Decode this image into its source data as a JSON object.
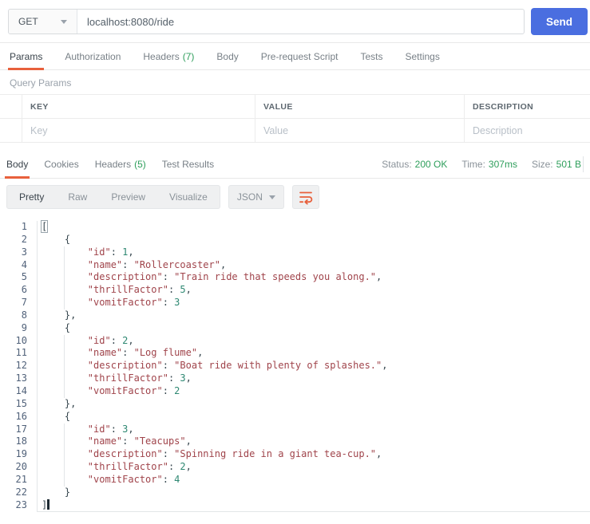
{
  "colors": {
    "accent_orange": "#E8603C",
    "green": "#2E9E5B",
    "send_blue": "#4A6EE0",
    "json_string": "#A0444B",
    "json_number": "#2E8872"
  },
  "request_bar": {
    "method": "GET",
    "url": "localhost:8080/ride",
    "send_label": "Send"
  },
  "request_tabs": [
    {
      "label": "Params",
      "active": true
    },
    {
      "label": "Authorization"
    },
    {
      "label": "Headers",
      "count": "(7)"
    },
    {
      "label": "Body"
    },
    {
      "label": "Pre-request Script"
    },
    {
      "label": "Tests"
    },
    {
      "label": "Settings"
    }
  ],
  "query_params": {
    "title": "Query Params",
    "columns": [
      "KEY",
      "VALUE",
      "DESCRIPTION"
    ],
    "placeholders": [
      "Key",
      "Value",
      "Description"
    ]
  },
  "response": {
    "tabs": [
      {
        "label": "Body",
        "active": true
      },
      {
        "label": "Cookies"
      },
      {
        "label": "Headers",
        "count": "(5)"
      },
      {
        "label": "Test Results"
      }
    ],
    "meta": [
      {
        "label": "Status:",
        "value": "200 OK"
      },
      {
        "label": "Time:",
        "value": "307ms"
      },
      {
        "label": "Size:",
        "value": "501 B"
      }
    ],
    "view_modes": [
      {
        "label": "Pretty",
        "active": true
      },
      {
        "label": "Raw"
      },
      {
        "label": "Preview"
      },
      {
        "label": "Visualize"
      }
    ],
    "format": "JSON"
  },
  "response_body": {
    "lines": [
      [
        [
          "match",
          "["
        ]
      ],
      [
        [
          "pun",
          "    {"
        ]
      ],
      [
        [
          "pun",
          "        "
        ],
        [
          "str",
          "\"id\""
        ],
        [
          "pun",
          ": "
        ],
        [
          "num",
          "1"
        ],
        [
          "pun",
          ","
        ]
      ],
      [
        [
          "pun",
          "        "
        ],
        [
          "str",
          "\"name\""
        ],
        [
          "pun",
          ": "
        ],
        [
          "str",
          "\"Rollercoaster\""
        ],
        [
          "pun",
          ","
        ]
      ],
      [
        [
          "pun",
          "        "
        ],
        [
          "str",
          "\"description\""
        ],
        [
          "pun",
          ": "
        ],
        [
          "str",
          "\"Train ride that speeds you along.\""
        ],
        [
          "pun",
          ","
        ]
      ],
      [
        [
          "pun",
          "        "
        ],
        [
          "str",
          "\"thrillFactor\""
        ],
        [
          "pun",
          ": "
        ],
        [
          "num",
          "5"
        ],
        [
          "pun",
          ","
        ]
      ],
      [
        [
          "pun",
          "        "
        ],
        [
          "str",
          "\"vomitFactor\""
        ],
        [
          "pun",
          ": "
        ],
        [
          "num",
          "3"
        ]
      ],
      [
        [
          "pun",
          "    },"
        ]
      ],
      [
        [
          "pun",
          "    {"
        ]
      ],
      [
        [
          "pun",
          "        "
        ],
        [
          "str",
          "\"id\""
        ],
        [
          "pun",
          ": "
        ],
        [
          "num",
          "2"
        ],
        [
          "pun",
          ","
        ]
      ],
      [
        [
          "pun",
          "        "
        ],
        [
          "str",
          "\"name\""
        ],
        [
          "pun",
          ": "
        ],
        [
          "str",
          "\"Log flume\""
        ],
        [
          "pun",
          ","
        ]
      ],
      [
        [
          "pun",
          "        "
        ],
        [
          "str",
          "\"description\""
        ],
        [
          "pun",
          ": "
        ],
        [
          "str",
          "\"Boat ride with plenty of splashes.\""
        ],
        [
          "pun",
          ","
        ]
      ],
      [
        [
          "pun",
          "        "
        ],
        [
          "str",
          "\"thrillFactor\""
        ],
        [
          "pun",
          ": "
        ],
        [
          "num",
          "3"
        ],
        [
          "pun",
          ","
        ]
      ],
      [
        [
          "pun",
          "        "
        ],
        [
          "str",
          "\"vomitFactor\""
        ],
        [
          "pun",
          ": "
        ],
        [
          "num",
          "2"
        ]
      ],
      [
        [
          "pun",
          "    },"
        ]
      ],
      [
        [
          "pun",
          "    {"
        ]
      ],
      [
        [
          "pun",
          "        "
        ],
        [
          "str",
          "\"id\""
        ],
        [
          "pun",
          ": "
        ],
        [
          "num",
          "3"
        ],
        [
          "pun",
          ","
        ]
      ],
      [
        [
          "pun",
          "        "
        ],
        [
          "str",
          "\"name\""
        ],
        [
          "pun",
          ": "
        ],
        [
          "str",
          "\"Teacups\""
        ],
        [
          "pun",
          ","
        ]
      ],
      [
        [
          "pun",
          "        "
        ],
        [
          "str",
          "\"description\""
        ],
        [
          "pun",
          ": "
        ],
        [
          "str",
          "\"Spinning ride in a giant tea-cup.\""
        ],
        [
          "pun",
          ","
        ]
      ],
      [
        [
          "pun",
          "        "
        ],
        [
          "str",
          "\"thrillFactor\""
        ],
        [
          "pun",
          ": "
        ],
        [
          "num",
          "2"
        ],
        [
          "pun",
          ","
        ]
      ],
      [
        [
          "pun",
          "        "
        ],
        [
          "str",
          "\"vomitFactor\""
        ],
        [
          "pun",
          ": "
        ],
        [
          "num",
          "4"
        ]
      ],
      [
        [
          "pun",
          "    }"
        ]
      ],
      [
        [
          "pun",
          "]"
        ],
        [
          "cursor",
          ""
        ]
      ]
    ]
  }
}
